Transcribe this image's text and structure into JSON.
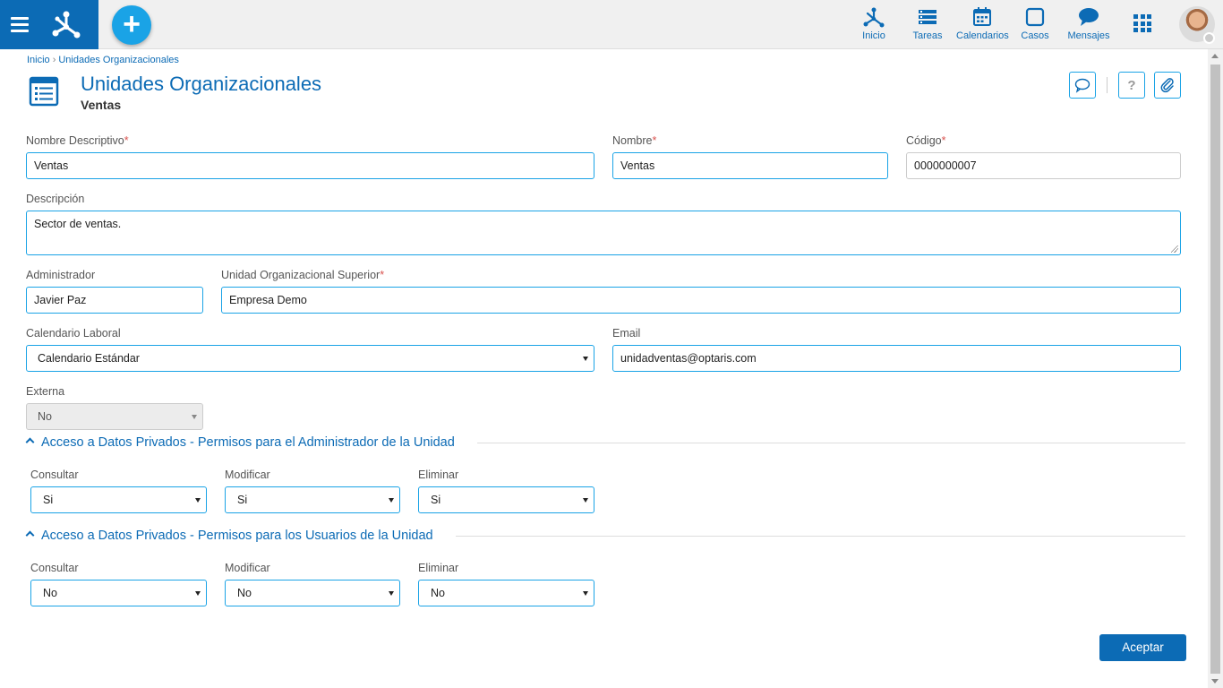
{
  "nav": {
    "items": [
      {
        "label": "Inicio",
        "icon": "process-icon"
      },
      {
        "label": "Tareas",
        "icon": "tasks-icon"
      },
      {
        "label": "Calendarios",
        "icon": "calendar-icon"
      },
      {
        "label": "Casos",
        "icon": "cases-icon"
      },
      {
        "label": "Mensajes",
        "icon": "chat-icon"
      }
    ],
    "add_label": "+"
  },
  "breadcrumb": {
    "home": "Inicio",
    "separator": "›",
    "current": "Unidades Organizacionales"
  },
  "page": {
    "title": "Unidades Organizacionales",
    "subtitle": "Ventas"
  },
  "form": {
    "nombre_descriptivo": {
      "label": "Nombre Descriptivo",
      "value": "Ventas",
      "required": "*"
    },
    "nombre": {
      "label": "Nombre",
      "value": "Ventas",
      "required": "*"
    },
    "codigo": {
      "label": "Código",
      "value": "0000000007",
      "required": "*"
    },
    "descripcion": {
      "label": "Descripción",
      "value": "Sector de ventas."
    },
    "administrador": {
      "label": "Administrador",
      "value": "Javier Paz"
    },
    "unidad_superior": {
      "label": "Unidad Organizacional Superior",
      "value": "Empresa Demo",
      "required": "*"
    },
    "calendario": {
      "label": "Calendario Laboral",
      "value": "Calendario Estándar"
    },
    "email": {
      "label": "Email",
      "value": "unidadventas@optaris.com"
    },
    "externa": {
      "label": "Externa",
      "value": "No"
    }
  },
  "sections": {
    "admin": {
      "title": "Acceso a Datos Privados - Permisos para el Administrador de la Unidad",
      "consultar": {
        "label": "Consultar",
        "value": "Si"
      },
      "modificar": {
        "label": "Modificar",
        "value": "Si"
      },
      "eliminar": {
        "label": "Eliminar",
        "value": "Si"
      }
    },
    "usuarios": {
      "title": "Acceso a Datos Privados - Permisos para los Usuarios de la Unidad",
      "consultar": {
        "label": "Consultar",
        "value": "No"
      },
      "modificar": {
        "label": "Modificar",
        "value": "No"
      },
      "eliminar": {
        "label": "Eliminar",
        "value": "No"
      }
    }
  },
  "actions": {
    "accept_label": "Aceptar"
  },
  "colors": {
    "brand": "#0c6bb5",
    "accent": "#1aa3e6",
    "required": "#d9534f"
  }
}
